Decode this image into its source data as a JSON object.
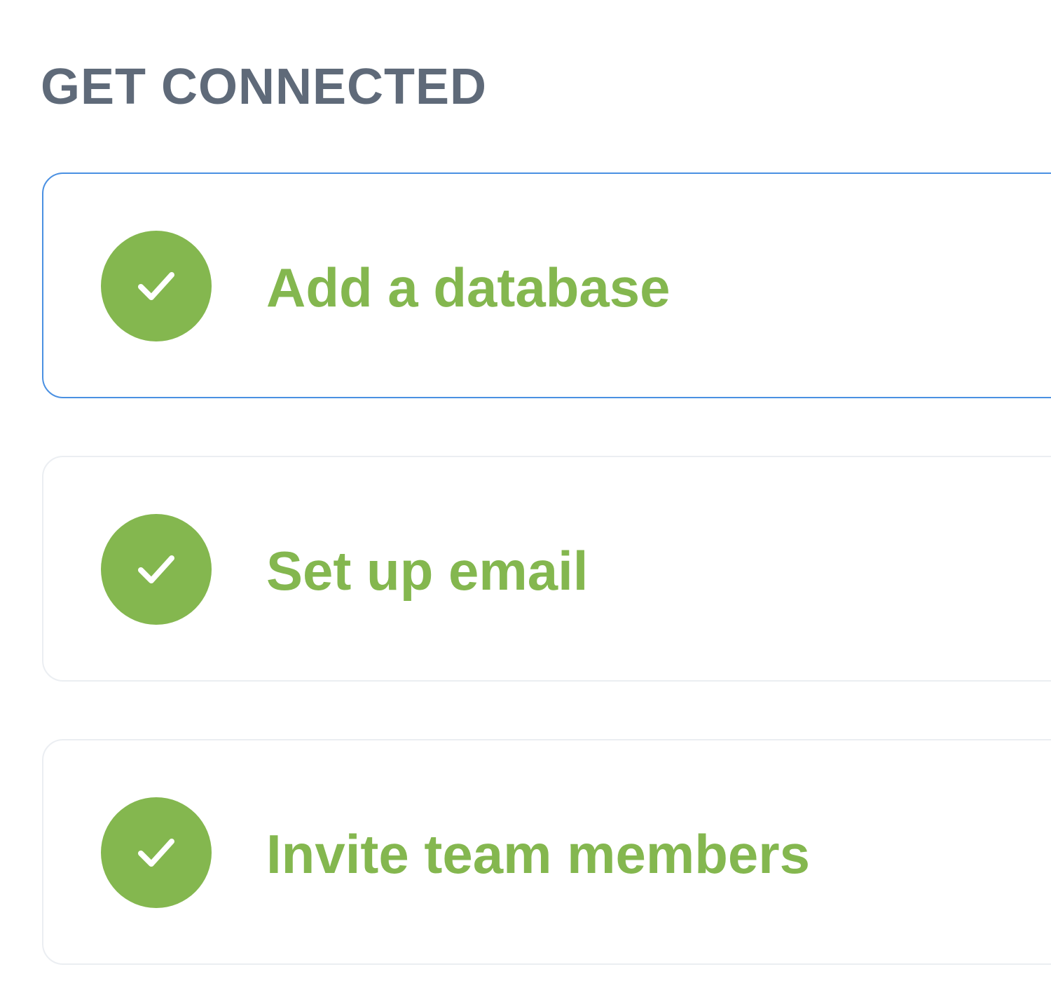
{
  "section": {
    "title": "GET CONNECTED"
  },
  "colors": {
    "complete": "#84b74f",
    "active_border": "#4a90e2",
    "card_border": "#ebeef2",
    "title": "#5f6a79"
  },
  "steps": [
    {
      "label": "Add a database",
      "status": "complete",
      "icon": "check-icon",
      "active": true
    },
    {
      "label": "Set up email",
      "status": "complete",
      "icon": "check-icon",
      "active": false
    },
    {
      "label": "Invite team members",
      "status": "complete",
      "icon": "check-icon",
      "active": false
    }
  ]
}
